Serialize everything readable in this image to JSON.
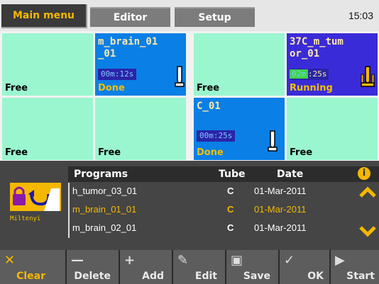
{
  "header": {
    "tabs": [
      {
        "label": "Main menu"
      },
      {
        "label": "Editor"
      },
      {
        "label": "Setup"
      }
    ],
    "clock": "15:03"
  },
  "slots": [
    {
      "status": "Free"
    },
    {
      "name": "m_brain_01\n_01",
      "timer": "00m:12s",
      "status": "Done"
    },
    {
      "status": "Free"
    },
    {
      "name": "37C_m_tum\nor_01",
      "timer_progress": "02m",
      "timer_rest": ":25s",
      "status": "Running"
    },
    {
      "status": "Free"
    },
    {
      "status": "Free"
    },
    {
      "name": "C_01",
      "timer": "00m:25s",
      "status": "Done"
    },
    {
      "status": "Free"
    }
  ],
  "programs": {
    "headers": {
      "program": "Programs",
      "tube": "Tube",
      "date": "Date"
    },
    "rows": [
      {
        "name": "h_tumor_03_01",
        "tube": "C",
        "date": "01-Mar-2011"
      },
      {
        "name": "m_brain_01_01",
        "tube": "C",
        "date": "01-Mar-2011"
      },
      {
        "name": "m_brain_02_01",
        "tube": "C",
        "date": "01-Mar-2011"
      }
    ],
    "selected_index": 1
  },
  "brand": {
    "label": "Miltenyi"
  },
  "toolbar": {
    "clear": "Clear",
    "delete": "Delete",
    "add": "Add",
    "edit": "Edit",
    "save": "Save",
    "ok": "OK",
    "start": "Start"
  },
  "colors": {
    "accent": "#f5b800",
    "free_slot": "#9af6cf",
    "done_slot": "#0a7fe6",
    "running_slot": "#3a2bd8"
  }
}
